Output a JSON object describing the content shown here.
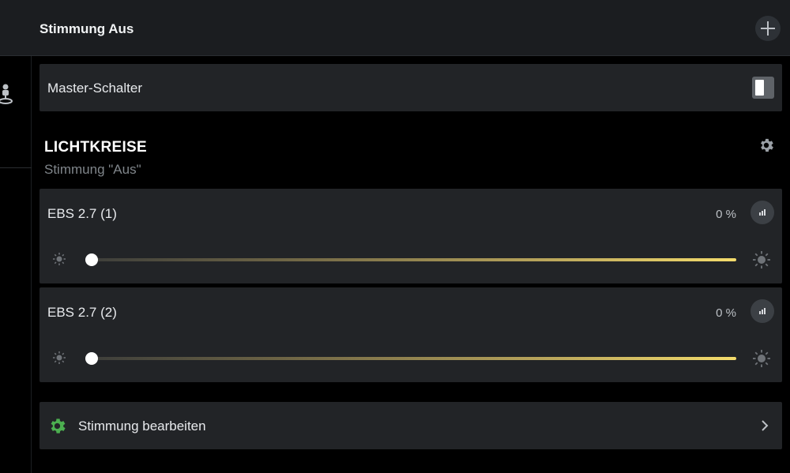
{
  "header": {
    "title": "Stimmung Aus",
    "add_icon": "plus-icon"
  },
  "master": {
    "label": "Master-Schalter",
    "toggle_state": "on"
  },
  "section": {
    "title": "LICHTKREISE",
    "subtitle": "Stimmung \"Aus\"",
    "settings_icon": "gear-icon"
  },
  "circuits": [
    {
      "name": "EBS 2.7 (1)",
      "percent_label": "0 %",
      "value": 0
    },
    {
      "name": "EBS 2.7 (2)",
      "percent_label": "0 %",
      "value": 0
    }
  ],
  "edit": {
    "label": "Stimmung bearbeiten",
    "icon": "gear-icon",
    "icon_color": "#4caf50"
  },
  "colors": {
    "background": "#000000",
    "card": "#222427",
    "accent_warm": "#f4dc6c",
    "edit_icon": "#4caf50"
  }
}
